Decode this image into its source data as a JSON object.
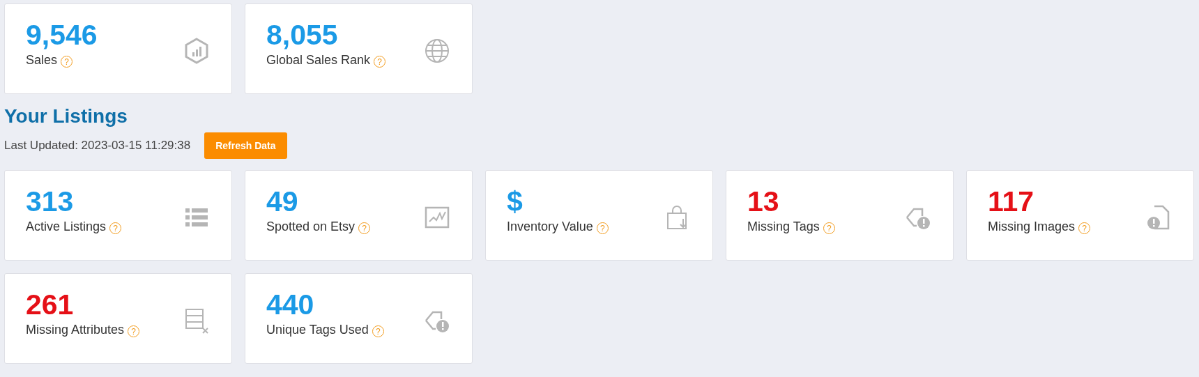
{
  "top_stats": [
    {
      "value": "9,546",
      "label": "Sales",
      "alert": false
    },
    {
      "value": "8,055",
      "label": "Global Sales Rank",
      "alert": false
    }
  ],
  "listings": {
    "title": "Your Listings",
    "last_updated": "Last Updated: 2023-03-15 11:29:38",
    "refresh_button": "Refresh Data",
    "stats": [
      {
        "value": "313",
        "label": "Active Listings",
        "alert": false
      },
      {
        "value": "49",
        "label": "Spotted on Etsy",
        "alert": false
      },
      {
        "value": "$",
        "label": "Inventory Value",
        "alert": false
      },
      {
        "value": "13",
        "label": "Missing Tags",
        "alert": true
      },
      {
        "value": "117",
        "label": "Missing Images",
        "alert": true
      },
      {
        "value": "261",
        "label": "Missing Attributes",
        "alert": true
      },
      {
        "value": "440",
        "label": "Unique Tags Used",
        "alert": false
      }
    ]
  },
  "help_mark": "?"
}
